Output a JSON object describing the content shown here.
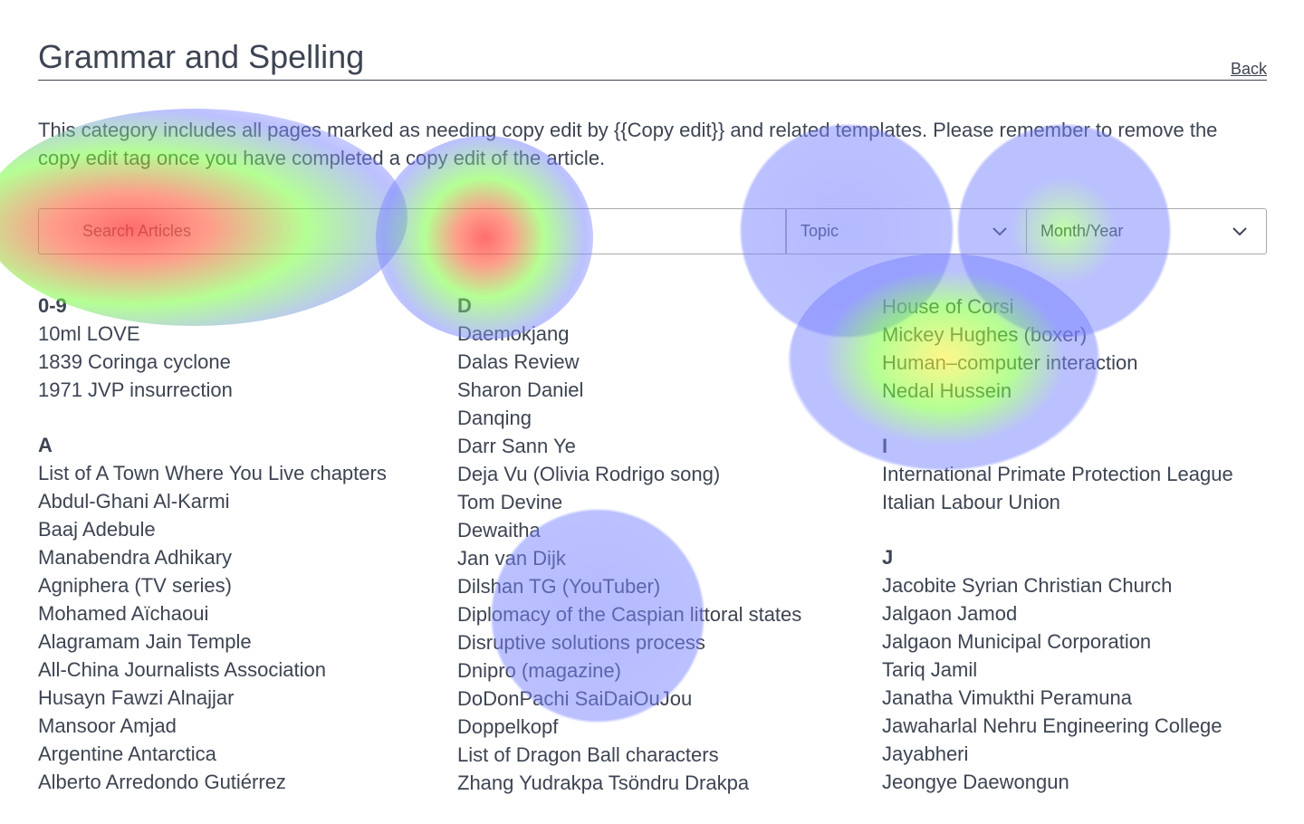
{
  "header": {
    "title": "Grammar and Spelling",
    "back_label": "Back"
  },
  "description": "This category includes all pages marked as needing copy edit by {{Copy edit}} and related templates. Please remember to remove the copy edit tag once you have completed a copy edit of the article.",
  "search": {
    "placeholder": "Search Articles"
  },
  "filters": {
    "topic_label": "Topic",
    "month_label": "Month/Year"
  },
  "columns": [
    {
      "groups": [
        {
          "letter": "0-9",
          "items": [
            "10ml LOVE",
            "1839 Coringa cyclone",
            "1971 JVP insurrection"
          ]
        },
        {
          "letter": "A",
          "items": [
            "List of A Town Where You Live chapters",
            "Abdul-Ghani Al-Karmi",
            "Baaj Adebule",
            "Manabendra Adhikary",
            "Agniphera (TV series)",
            "Mohamed Aïchaoui",
            "Alagramam Jain Temple",
            "All-China Journalists Association",
            "Husayn Fawzi Alnajjar",
            "Mansoor Amjad",
            "Argentine Antarctica",
            "Alberto Arredondo Gutiérrez"
          ]
        }
      ]
    },
    {
      "groups": [
        {
          "letter": "D",
          "items": [
            "Daemokjang",
            "Dalas Review",
            "Sharon Daniel",
            "Danqing",
            "Darr Sann Ye",
            "Deja Vu (Olivia Rodrigo song)",
            "Tom Devine",
            "Dewaitha",
            "Jan van Dijk",
            "Dilshan TG (YouTuber)",
            "Diplomacy of the Caspian littoral states",
            "Disruptive solutions process",
            "Dnipro (magazine)",
            "DoDonPachi SaiDaiOuJou",
            "Doppelkopf",
            "List of Dragon Ball characters",
            "Zhang Yudrakpa Tsöndru Drakpa"
          ]
        }
      ]
    },
    {
      "groups": [
        {
          "letter": "",
          "items": [
            "House of Corsi",
            "Mickey Hughes (boxer)",
            "Human–computer interaction",
            "Nedal Hussein"
          ]
        },
        {
          "letter": "I",
          "items": [
            "International Primate Protection League",
            "Italian Labour Union"
          ]
        },
        {
          "letter": "J",
          "items": [
            "Jacobite Syrian Christian Church",
            "Jalgaon Jamod",
            "Jalgaon Municipal Corporation",
            "Tariq Jamil",
            "Janatha Vimukthi Peramuna",
            "Jawaharlal Nehru Engineering College",
            "Jayabheri",
            "Jeongye Daewongun"
          ]
        }
      ]
    }
  ]
}
